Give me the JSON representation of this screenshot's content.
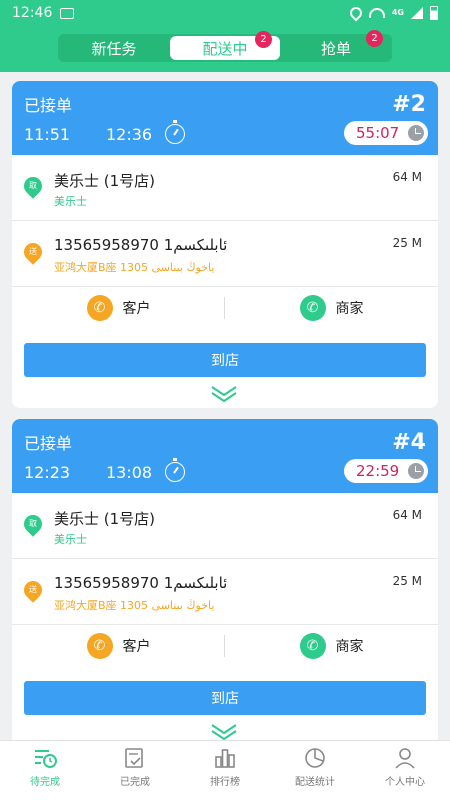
{
  "status_bar": {
    "time": "12:46",
    "network": "4G"
  },
  "segments": [
    {
      "label": "新任务",
      "badge": ""
    },
    {
      "label": "配送中",
      "badge": "2"
    },
    {
      "label": "抢单",
      "badge": "2"
    }
  ],
  "orders": [
    {
      "status": "已接单",
      "number": "#2",
      "time_start": "11:51",
      "time_end": "12:36",
      "countdown": "55:07",
      "pickup": {
        "tag": "取",
        "name": "美乐士 (1号店)",
        "sub": "美乐士",
        "distance": "64 M"
      },
      "delivery": {
        "tag": "送",
        "name": "13565958970 1ئابلىكسم",
        "sub": "亚鸿大厦B座 1305 ياخوڭ بىناسى",
        "distance": "25 M"
      },
      "customer_label": "客户",
      "merchant_label": "商家",
      "action_label": "到店"
    },
    {
      "status": "已接单",
      "number": "#4",
      "time_start": "12:23",
      "time_end": "13:08",
      "countdown": "22:59",
      "pickup": {
        "tag": "取",
        "name": "美乐士 (1号店)",
        "sub": "美乐士",
        "distance": "64 M"
      },
      "delivery": {
        "tag": "送",
        "name": "13565958970 1ئابلىكسم",
        "sub": "亚鸿大厦B座 1305 ياخوڭ بىناسى",
        "distance": "25 M"
      },
      "customer_label": "客户",
      "merchant_label": "商家",
      "action_label": "到店"
    }
  ],
  "tabs": [
    {
      "label": "待完成",
      "icon": "list-clock-icon"
    },
    {
      "label": "已完成",
      "icon": "check-doc-icon"
    },
    {
      "label": "排行榜",
      "icon": "bar-chart-icon"
    },
    {
      "label": "配送统计",
      "icon": "pie-chart-icon"
    },
    {
      "label": "个人中心",
      "icon": "user-icon"
    }
  ],
  "colors": {
    "brand": "#2ecb8c",
    "card_header": "#3a9ff3",
    "badge": "#e8245f",
    "countdown": "#d0245e",
    "delivery": "#f5a623"
  }
}
